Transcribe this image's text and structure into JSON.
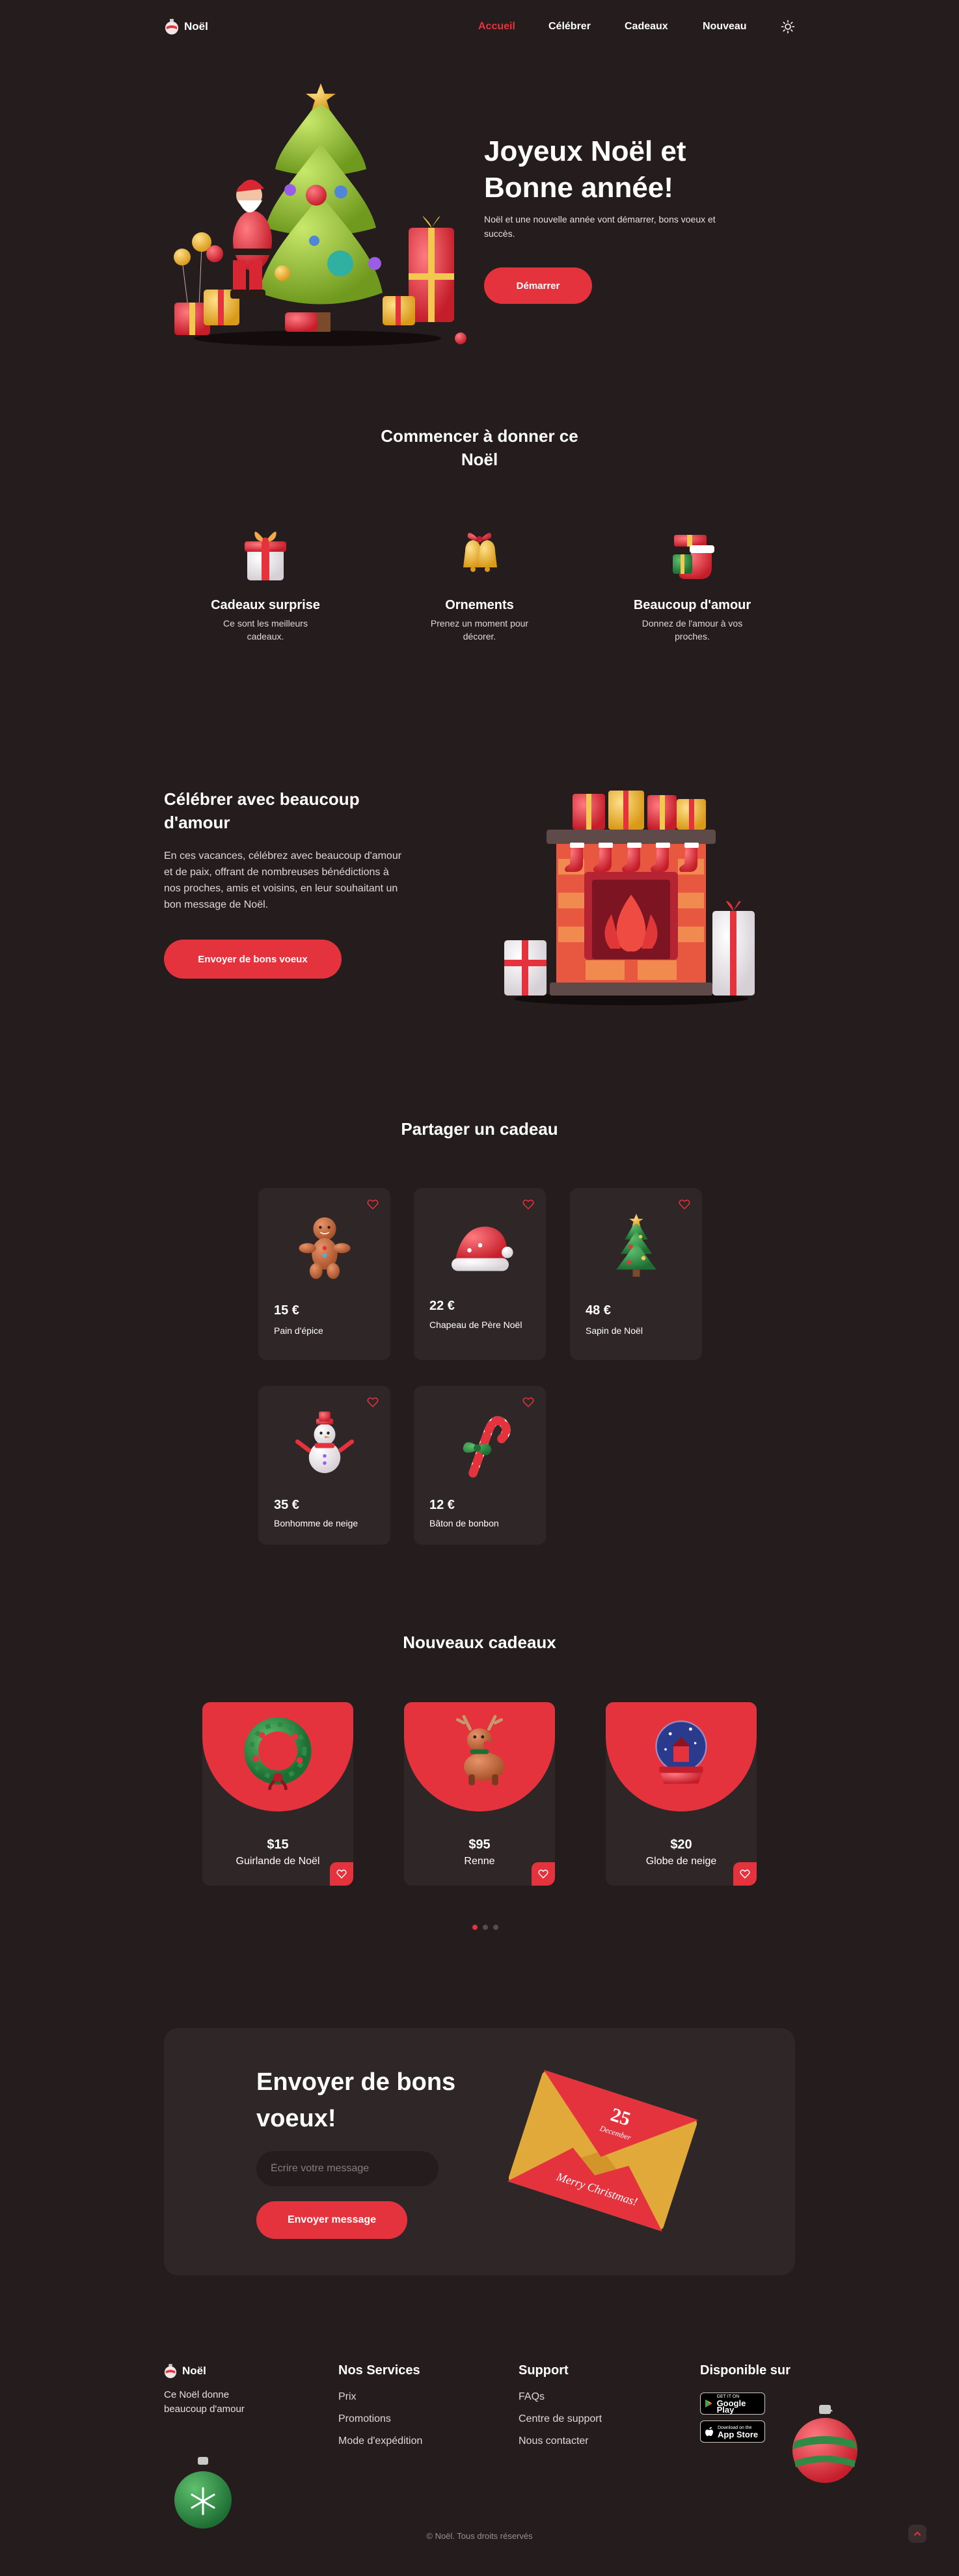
{
  "header": {
    "logo": "Noël",
    "nav": [
      "Accueil",
      "Célébrer",
      "Cadeaux",
      "Nouveau"
    ]
  },
  "hero": {
    "title": "Joyeux Noël et Bonne année!",
    "subtitle": "Noël et une nouvelle année vont démarrer, bons voeux et succès.",
    "button": "Démarrer"
  },
  "services": {
    "title": "Commencer à donner ce Noël",
    "items": [
      {
        "title": "Cadeaux surprise",
        "text": "Ce sont les meilleurs cadeaux."
      },
      {
        "title": "Ornements",
        "text": "Prenez un moment pour décorer."
      },
      {
        "title": "Beaucoup d'amour",
        "text": "Donnez de l'amour à vos proches."
      }
    ]
  },
  "celebrate": {
    "title": "Célébrer avec beaucoup d'amour",
    "text": "En ces vacances, célébrez avec beaucoup d'amour et de paix, offrant de nombreuses bénédictions à nos proches, amis et voisins, en leur souhaitant un bon message de Noël.",
    "button": "Envoyer de bons voeux"
  },
  "gifts": {
    "title": "Partager un cadeau",
    "items": [
      {
        "price": "15 €",
        "name": "Pain d'épice",
        "icon": "gingerbread-icon"
      },
      {
        "price": "22 €",
        "name": "Chapeau de Père Noël",
        "icon": "santa-hat-icon"
      },
      {
        "price": "48 €",
        "name": "Sapin de Noël",
        "icon": "christmas-tree-icon"
      },
      {
        "price": "35 €",
        "name": "Bonhomme de neige",
        "icon": "snowman-icon"
      },
      {
        "price": "12 €",
        "name": "Bâton de bonbon",
        "icon": "candy-cane-icon"
      }
    ]
  },
  "new_gifts": {
    "title": "Nouveaux cadeaux",
    "items": [
      {
        "price": "$15",
        "name": "Guirlande de Noël",
        "icon": "wreath-icon"
      },
      {
        "price": "$95",
        "name": "Renne",
        "icon": "reindeer-icon"
      },
      {
        "price": "$20",
        "name": "Globe de neige",
        "icon": "snow-globe-icon"
      }
    ],
    "active_page": 1,
    "page_count": 3
  },
  "message": {
    "title": "Envoyer de bons voeux!",
    "placeholder": "Écrire votre message",
    "button": "Envoyer message",
    "envelope_day": "25",
    "envelope_month": "December",
    "envelope_greeting": "Merry Christmas!"
  },
  "footer": {
    "logo": "Noël",
    "description": "Ce Noël donne beaucoup d'amour",
    "services_title": "Nos Services",
    "services": [
      "Prix",
      "Promotions",
      "Mode d'expédition"
    ],
    "support_title": "Support",
    "support": [
      "FAQs",
      "Centre de support",
      "Nous contacter"
    ],
    "available_title": "Disponible sur",
    "google_small": "GET IT ON",
    "google_big": "Google Play",
    "apple_small": "Download on the",
    "apple_big": "App Store",
    "copyright": "© Noël. Tous droits réservés"
  },
  "colors": {
    "background": "#241c1d",
    "card": "#2f2627",
    "accent": "#e5333e"
  }
}
